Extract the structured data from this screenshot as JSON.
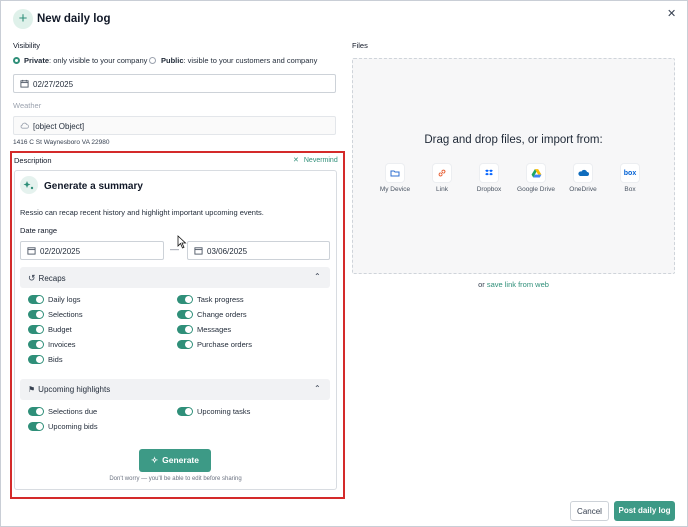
{
  "header": {
    "title": "New daily log",
    "plus_icon": "plus-icon",
    "close_icon": "close-icon"
  },
  "visibility": {
    "label": "Visibility",
    "private_title": "Private",
    "private_desc": ": only visible to your company",
    "public_title": "Public",
    "public_desc": ": visible to your customers and company",
    "selected": "private"
  },
  "date_field": {
    "value": "02/27/2025"
  },
  "weather": {
    "label": "Weather",
    "value": "[object Object]",
    "address": "1416 C St Waynesboro VA 22980"
  },
  "description": {
    "label": "Description",
    "nevermind": "Nevermind"
  },
  "summary": {
    "title": "Generate a summary",
    "intro": "Ressio can recap recent history and highlight important upcoming events.",
    "date_range_label": "Date range",
    "start_date": "02/20/2025",
    "end_date": "03/06/2025",
    "dash": "—",
    "recaps": {
      "title": "Recaps",
      "left": [
        "Daily logs",
        "Selections",
        "Budget",
        "Invoices",
        "Bids"
      ],
      "right": [
        "Task progress",
        "Change orders",
        "Messages",
        "Purchase orders"
      ]
    },
    "upcoming": {
      "title": "Upcoming highlights",
      "left": [
        "Selections due",
        "Upcoming bids"
      ],
      "right": [
        "Upcoming tasks"
      ]
    },
    "generate_label": "Generate",
    "footnote": "Don't worry — you'll be able to edit before sharing"
  },
  "files": {
    "label": "Files",
    "drop_title": "Drag and drop files, or import from:",
    "sources": [
      {
        "label": "My Device",
        "icon": "folder-icon",
        "color": "#2f6fd1"
      },
      {
        "label": "Link",
        "icon": "link-icon",
        "color": "#e8663d"
      },
      {
        "label": "Dropbox",
        "icon": "dropbox-icon",
        "color": "#0061fe"
      },
      {
        "label": "Google Drive",
        "icon": "google-drive-icon",
        "color": "#1fa463"
      },
      {
        "label": "OneDrive",
        "icon": "onedrive-icon",
        "color": "#0f6cbd"
      },
      {
        "label": "Box",
        "icon": "box-icon",
        "color": "#0061d5"
      }
    ],
    "or_text": "or",
    "save_link": "save link from web"
  },
  "footer": {
    "cancel": "Cancel",
    "post": "Post daily log"
  },
  "colors": {
    "accent": "#2f8f79",
    "highlight_border": "#d42a2a"
  }
}
